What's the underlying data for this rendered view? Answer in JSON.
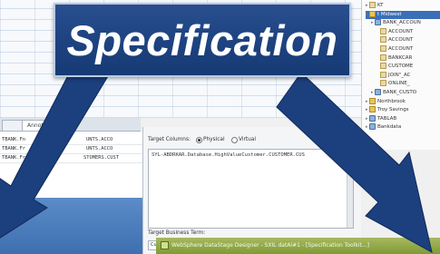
{
  "banner": {
    "title": "Specification"
  },
  "tree": {
    "items": [
      {
        "label": "KT",
        "indent": 0,
        "icon": "file-icon"
      },
      {
        "label": "t Midwest",
        "indent": 0,
        "icon": "folder-icon",
        "selected": true
      },
      {
        "label": "BANK_ACCOUN",
        "indent": 1,
        "icon": "db-icon"
      },
      {
        "label": "ACCOUNT",
        "indent": 2,
        "icon": "file-icon"
      },
      {
        "label": "ACCOUNT",
        "indent": 2,
        "icon": "file-icon"
      },
      {
        "label": "ACCOUNT",
        "indent": 2,
        "icon": "file-icon"
      },
      {
        "label": "BANKCAR",
        "indent": 2,
        "icon": "file-icon"
      },
      {
        "label": "CUSTOME",
        "indent": 2,
        "icon": "file-icon"
      },
      {
        "label": "JOIN\"_AC",
        "indent": 2,
        "icon": "file-icon"
      },
      {
        "label": "ONLINE_",
        "indent": 2,
        "icon": "file-icon"
      },
      {
        "label": "BANK_CUSTO",
        "indent": 1,
        "icon": "db-icon"
      },
      {
        "label": "Northbrook",
        "indent": 0,
        "icon": "folder-icon"
      },
      {
        "label": "Troy Savings",
        "indent": 0,
        "icon": "folder-icon"
      },
      {
        "label": "TABLAB",
        "indent": 0,
        "icon": "db-icon"
      },
      {
        "label": "Bankdata",
        "indent": 0,
        "icon": "db-icon"
      }
    ]
  },
  "tabs": [
    {
      "label": ""
    },
    {
      "label": "Annotation"
    }
  ],
  "table": {
    "rows": [
      {
        "c1": "TBANK.Fn",
        "c2": "UNTS.ACCO"
      },
      {
        "c1": "TBANK.Fr",
        "c2": "UNTS.ACCO"
      },
      {
        "c1": "TBANK.Fr",
        "c2": "STOMERS.CUST"
      }
    ]
  },
  "dialog": {
    "target_columns_label": "Target Columns:",
    "physical_label": "Physical",
    "virtual_label": "Virtual",
    "target_value": "SYL-ABDRKAR.Database.HighValueCustomer.CUSTOMER.CUS",
    "target_business_term_label": "Target Business Term:",
    "small_input": "Cust"
  },
  "taskbar": {
    "title": "WebSphere DataStage Designer - SXIL datAl#1 - [Specification Toolkit...]"
  },
  "colors": {
    "banner": "#1f4482",
    "arrow": "#1c3f7e",
    "taskbar": "#8fa845"
  }
}
